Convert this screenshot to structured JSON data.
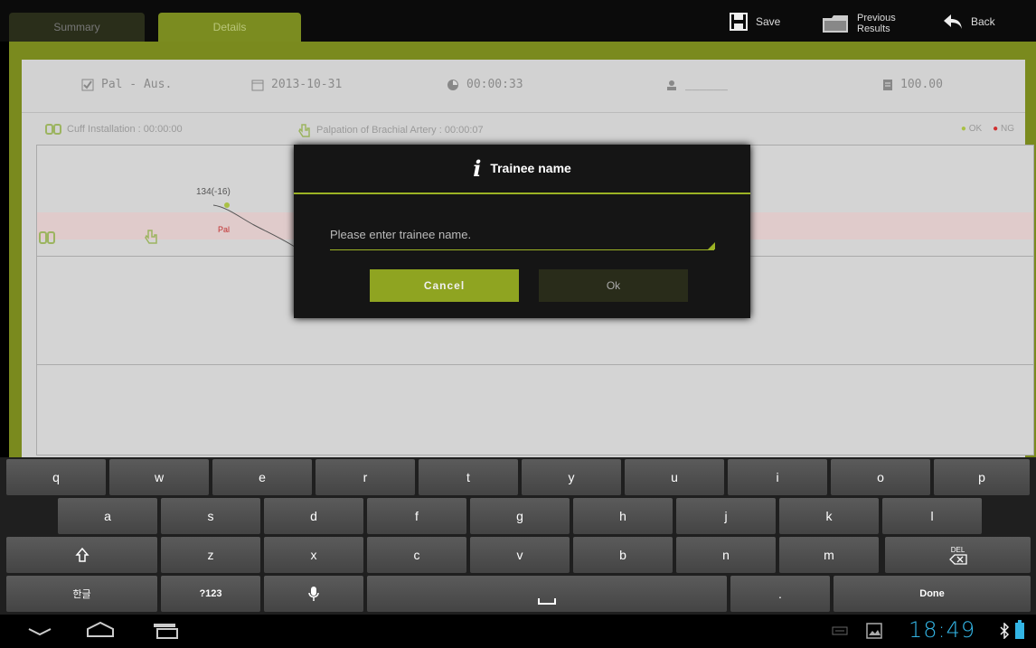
{
  "tabs": [
    {
      "label": "Summary"
    },
    {
      "label": "Details"
    }
  ],
  "toolbar": {
    "save_label": "Save",
    "previous_results_label_line1": "Previous",
    "previous_results_label_line2": "Results",
    "back_label": "Back"
  },
  "info": {
    "mode": "Pal - Aus.",
    "date": "2013-10-31",
    "elapsed": "00:00:33",
    "user": "______",
    "score": "100.00"
  },
  "procedures": {
    "cuff_installation": "Cuff Installation : 00:00:00",
    "palpation": "Palpation of Brachial Artery : 00:00:07",
    "legend_ok": "OK",
    "legend_ng": "NG"
  },
  "chart": {
    "point_label": "134(-16)",
    "pal_label": "Pal"
  },
  "dialog": {
    "title": "Trainee name",
    "placeholder": "Please enter trainee name.",
    "cancel_label": "Cancel",
    "ok_label": "Ok"
  },
  "keyboard": {
    "row1": [
      "q",
      "w",
      "e",
      "r",
      "t",
      "y",
      "u",
      "i",
      "o",
      "p"
    ],
    "row2": [
      "a",
      "s",
      "d",
      "f",
      "g",
      "h",
      "j",
      "k",
      "l"
    ],
    "row3": [
      "z",
      "x",
      "c",
      "v",
      "b",
      "n",
      "m"
    ],
    "del_label": "DEL",
    "lang_label": "한글",
    "symbols_label": "?123",
    "period_label": ".",
    "done_label": "Done"
  },
  "status": {
    "clock": "18:49"
  },
  "colors": {
    "accent": "#9bb224",
    "clock": "#33b5e5"
  }
}
